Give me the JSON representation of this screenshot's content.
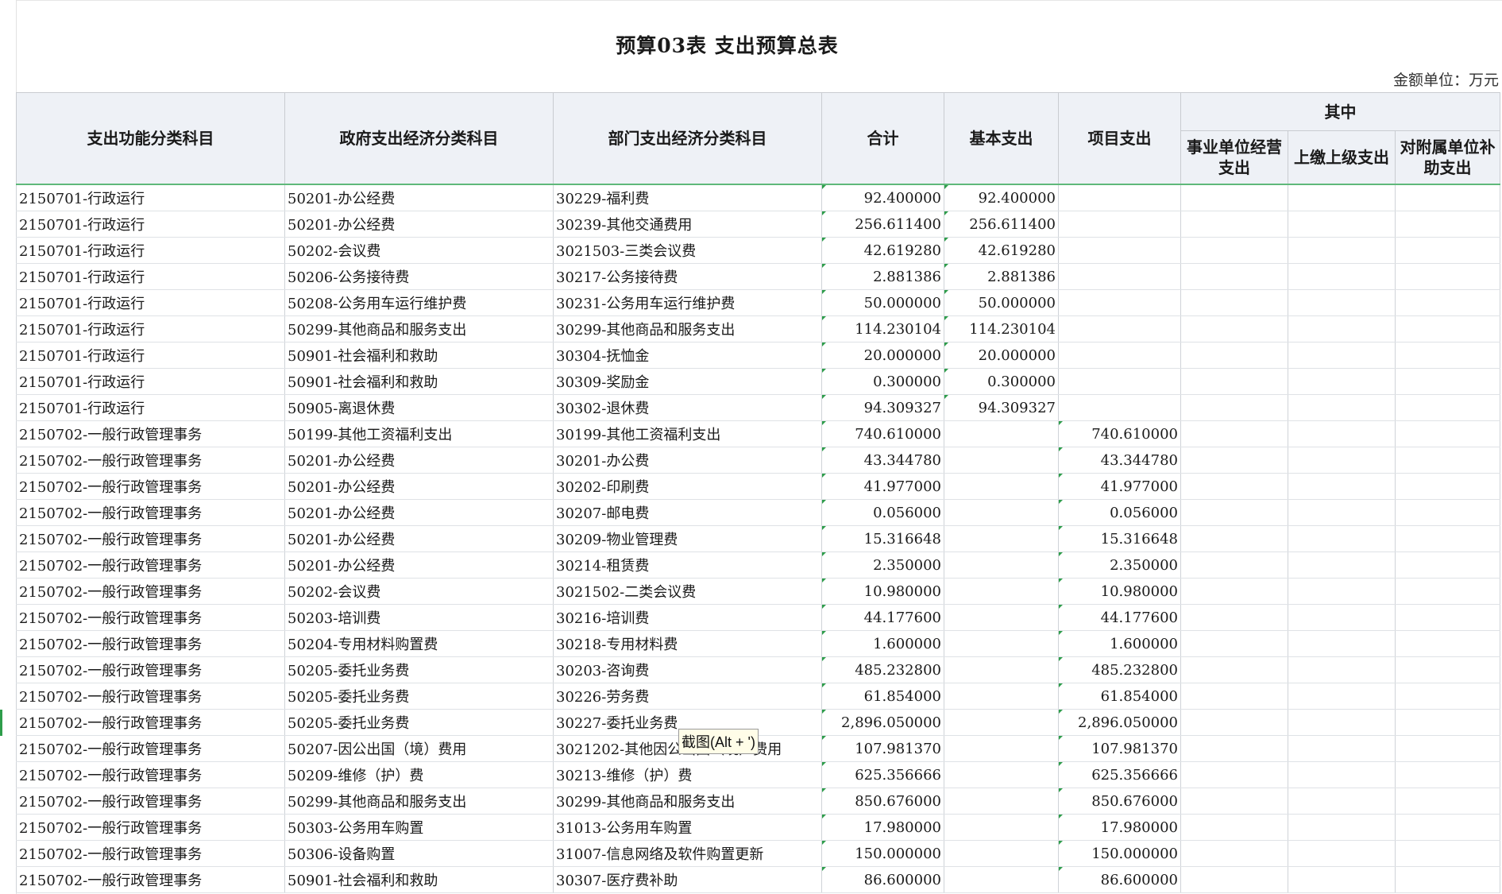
{
  "title": "预算03表  支出预算总表",
  "unit": "金额单位：万元",
  "tooltip": "截图(Alt + ')",
  "headers": {
    "func_subject": "支出功能分类科目",
    "gov_econ_subject": "政府支出经济分类科目",
    "dept_econ_subject": "部门支出经济分类科目",
    "total": "合计",
    "basic": "基本支出",
    "project": "项目支出",
    "of_which": "其中",
    "sub_business": "事业单位经营支出",
    "sub_upper": "上缴上级支出",
    "sub_subsidy": "对附属单位补助支出"
  },
  "rows": [
    {
      "func": "2150701-行政运行",
      "gov": "50201-办公经费",
      "dept": "30229-福利费",
      "total": "92.400000",
      "basic": "92.400000",
      "project": ""
    },
    {
      "func": "2150701-行政运行",
      "gov": "50201-办公经费",
      "dept": "30239-其他交通费用",
      "total": "256.611400",
      "basic": "256.611400",
      "project": ""
    },
    {
      "func": "2150701-行政运行",
      "gov": "50202-会议费",
      "dept": "3021503-三类会议费",
      "total": "42.619280",
      "basic": "42.619280",
      "project": ""
    },
    {
      "func": "2150701-行政运行",
      "gov": "50206-公务接待费",
      "dept": "30217-公务接待费",
      "total": "2.881386",
      "basic": "2.881386",
      "project": ""
    },
    {
      "func": "2150701-行政运行",
      "gov": "50208-公务用车运行维护费",
      "dept": "30231-公务用车运行维护费",
      "total": "50.000000",
      "basic": "50.000000",
      "project": ""
    },
    {
      "func": "2150701-行政运行",
      "gov": "50299-其他商品和服务支出",
      "dept": "30299-其他商品和服务支出",
      "total": "114.230104",
      "basic": "114.230104",
      "project": ""
    },
    {
      "func": "2150701-行政运行",
      "gov": "50901-社会福利和救助",
      "dept": "30304-抚恤金",
      "total": "20.000000",
      "basic": "20.000000",
      "project": ""
    },
    {
      "func": "2150701-行政运行",
      "gov": "50901-社会福利和救助",
      "dept": "30309-奖励金",
      "total": "0.300000",
      "basic": "0.300000",
      "project": ""
    },
    {
      "func": "2150701-行政运行",
      "gov": "50905-离退休费",
      "dept": "30302-退休费",
      "total": "94.309327",
      "basic": "94.309327",
      "project": ""
    },
    {
      "func": "2150702-一般行政管理事务",
      "gov": "50199-其他工资福利支出",
      "dept": "30199-其他工资福利支出",
      "total": "740.610000",
      "basic": "",
      "project": "740.610000"
    },
    {
      "func": "2150702-一般行政管理事务",
      "gov": "50201-办公经费",
      "dept": "30201-办公费",
      "total": "43.344780",
      "basic": "",
      "project": "43.344780"
    },
    {
      "func": "2150702-一般行政管理事务",
      "gov": "50201-办公经费",
      "dept": "30202-印刷费",
      "total": "41.977000",
      "basic": "",
      "project": "41.977000"
    },
    {
      "func": "2150702-一般行政管理事务",
      "gov": "50201-办公经费",
      "dept": "30207-邮电费",
      "total": "0.056000",
      "basic": "",
      "project": "0.056000"
    },
    {
      "func": "2150702-一般行政管理事务",
      "gov": "50201-办公经费",
      "dept": "30209-物业管理费",
      "total": "15.316648",
      "basic": "",
      "project": "15.316648"
    },
    {
      "func": "2150702-一般行政管理事务",
      "gov": "50201-办公经费",
      "dept": "30214-租赁费",
      "total": "2.350000",
      "basic": "",
      "project": "2.350000"
    },
    {
      "func": "2150702-一般行政管理事务",
      "gov": "50202-会议费",
      "dept": "3021502-二类会议费",
      "total": "10.980000",
      "basic": "",
      "project": "10.980000"
    },
    {
      "func": "2150702-一般行政管理事务",
      "gov": "50203-培训费",
      "dept": "30216-培训费",
      "total": "44.177600",
      "basic": "",
      "project": "44.177600"
    },
    {
      "func": "2150702-一般行政管理事务",
      "gov": "50204-专用材料购置费",
      "dept": "30218-专用材料费",
      "total": "1.600000",
      "basic": "",
      "project": "1.600000"
    },
    {
      "func": "2150702-一般行政管理事务",
      "gov": "50205-委托业务费",
      "dept": "30203-咨询费",
      "total": "485.232800",
      "basic": "",
      "project": "485.232800"
    },
    {
      "func": "2150702-一般行政管理事务",
      "gov": "50205-委托业务费",
      "dept": "30226-劳务费",
      "total": "61.854000",
      "basic": "",
      "project": "61.854000"
    },
    {
      "func": "2150702-一般行政管理事务",
      "gov": "50205-委托业务费",
      "dept": "30227-委托业务费",
      "total": "2,896.050000",
      "basic": "",
      "project": "2,896.050000"
    },
    {
      "func": "2150702-一般行政管理事务",
      "gov": "50207-因公出国（境）费用",
      "dept": "3021202-其他因公出国（境）费用",
      "total": "107.981370",
      "basic": "",
      "project": "107.981370"
    },
    {
      "func": "2150702-一般行政管理事务",
      "gov": "50209-维修（护）费",
      "dept": "30213-维修（护）费",
      "total": "625.356666",
      "basic": "",
      "project": "625.356666"
    },
    {
      "func": "2150702-一般行政管理事务",
      "gov": "50299-其他商品和服务支出",
      "dept": "30299-其他商品和服务支出",
      "total": "850.676000",
      "basic": "",
      "project": "850.676000"
    },
    {
      "func": "2150702-一般行政管理事务",
      "gov": "50303-公务用车购置",
      "dept": "31013-公务用车购置",
      "total": "17.980000",
      "basic": "",
      "project": "17.980000"
    },
    {
      "func": "2150702-一般行政管理事务",
      "gov": "50306-设备购置",
      "dept": "31007-信息网络及软件购置更新",
      "total": "150.000000",
      "basic": "",
      "project": "150.000000"
    },
    {
      "func": "2150702-一般行政管理事务",
      "gov": "50901-社会福利和救助",
      "dept": "30307-医疗费补助",
      "total": "86.600000",
      "basic": "",
      "project": "86.600000"
    }
  ]
}
